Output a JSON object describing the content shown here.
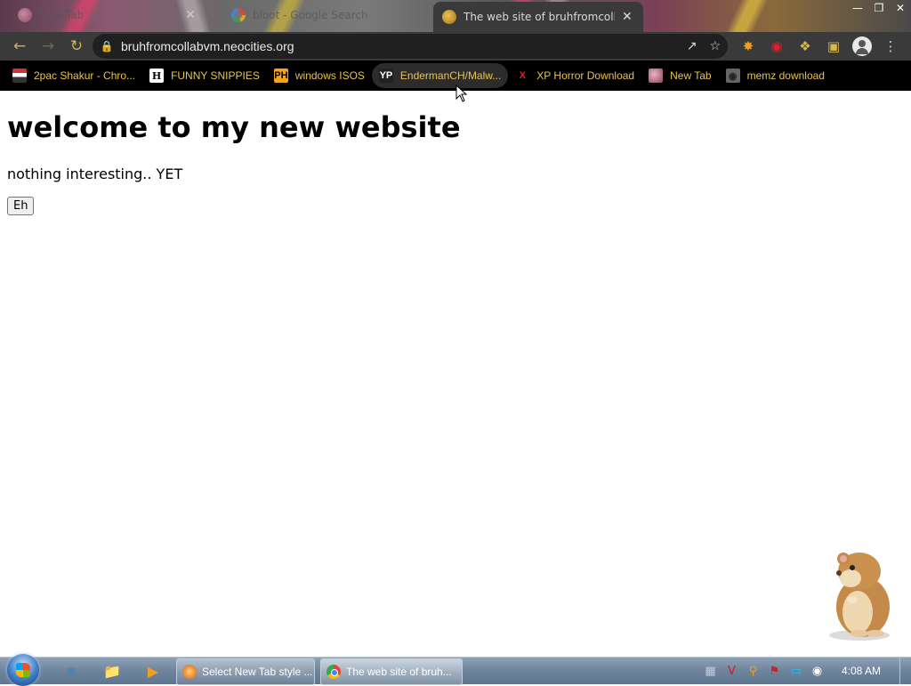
{
  "browser": {
    "tabs": [
      {
        "title": "New Tab",
        "state": "inactive"
      },
      {
        "title": "bloot - Google Search",
        "state": "inactive"
      },
      {
        "title": "The web site of bruhfromcollabvm",
        "state": "active"
      }
    ],
    "close_glyph": "✕",
    "url": "bruhfromcollabvm.neocities.org",
    "bookmarks": [
      {
        "label": "2pac Shakur - Chro...",
        "icon": "2pac-icon"
      },
      {
        "label": "FUNNY SNIPPIES",
        "icon": "h-icon"
      },
      {
        "label": "windows ISOS",
        "icon": "ph-icon"
      },
      {
        "label": "EndermanCH/Malw...",
        "icon": "yp-icon"
      },
      {
        "label": "XP Horror Download",
        "icon": "x-icon"
      },
      {
        "label": "New Tab",
        "icon": "new-tab-icon"
      },
      {
        "label": "memz download",
        "icon": "globe-icon"
      }
    ],
    "accent_color": "#e8c44a"
  },
  "page": {
    "heading": "welcome to my new website",
    "paragraph": "nothing interesting.. YET",
    "button_label": "Eh"
  },
  "taskbar": {
    "tasks": [
      {
        "label": "Select New Tab style ...",
        "icon": "new-tab-extension-icon"
      },
      {
        "label": "The web site of bruh...",
        "icon": "chrome-icon"
      }
    ],
    "clock": "4:08 AM"
  }
}
